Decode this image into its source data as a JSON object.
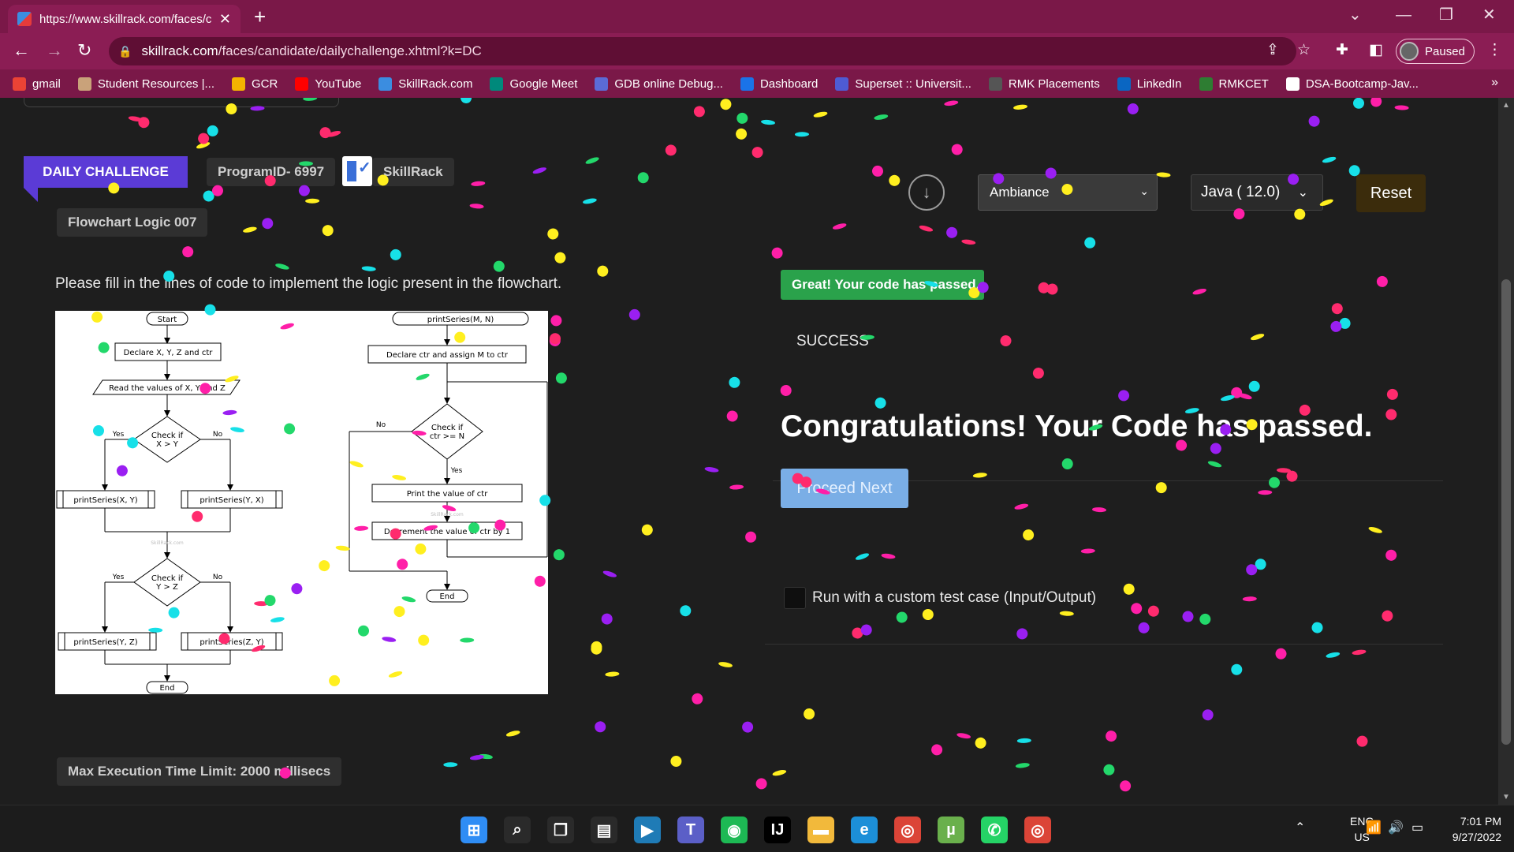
{
  "browser": {
    "tab_title": "https://www.skillrack.com/faces/c",
    "url_domain": "skillrack.com",
    "url_path": "/faces/candidate/dailychallenge.xhtml?k=DC",
    "profile_status": "Paused",
    "bookmarks": [
      {
        "label": "gmail",
        "color": "#ea4335"
      },
      {
        "label": "Student Resources |...",
        "color": "#c9a27a"
      },
      {
        "label": "GCR",
        "color": "#f4b400"
      },
      {
        "label": "YouTube",
        "color": "#ff0000"
      },
      {
        "label": "SkillRack.com",
        "color": "#3b8de0"
      },
      {
        "label": "Google Meet",
        "color": "#00897b"
      },
      {
        "label": "GDB online Debug...",
        "color": "#5b6bd6"
      },
      {
        "label": "Dashboard",
        "color": "#1a73e8"
      },
      {
        "label": "Superset :: Universit...",
        "color": "#4e5bd4"
      },
      {
        "label": "RMK Placements",
        "color": "#555555"
      },
      {
        "label": "LinkedIn",
        "color": "#0a66c2"
      },
      {
        "label": "RMKCET",
        "color": "#2e7d32"
      },
      {
        "label": "DSA-Bootcamp-Jav...",
        "color": "#ffffff"
      }
    ]
  },
  "challenge": {
    "badge": "DAILY CHALLENGE",
    "program_id": "ProgramID- 6997",
    "brand": "SkillRack",
    "title": "Flowchart Logic 007",
    "problem_text": "Please fill in the lines of code to implement the logic present in the flowchart.",
    "max_exec": "Max Execution Time Limit: 2000 millisecs"
  },
  "flowchart": {
    "left": {
      "start": "Start",
      "declare": "Declare X, Y, Z and ctr",
      "read": "Read the values of X, Y and Z",
      "cond1": [
        "Check if",
        "X > Y"
      ],
      "yes": "Yes",
      "no": "No",
      "p1": "printSeries(X, Y)",
      "p2": "printSeries(Y, X)",
      "cond2": [
        "Check if",
        "Y > Z"
      ],
      "p3": "printSeries(Y, Z)",
      "p4": "printSeries(Z, Y)",
      "end": "End",
      "watermark": "SkillRack.com"
    },
    "right": {
      "start": "printSeries(M, N)",
      "declare": "Declare ctr and assign M to ctr",
      "cond": [
        "Check if",
        "ctr >= N"
      ],
      "no": "No",
      "yes": "Yes",
      "print": "Print the value of ctr",
      "dec": "Decrement the value of ctr by 1",
      "end": "End",
      "watermark": "SkillRack.com"
    }
  },
  "editor": {
    "theme": "Ambiance",
    "language": "Java ( 12.0)",
    "reset": "Reset",
    "pass_badge": "Great! Your code has passed.",
    "status": "SUCCESS",
    "congrats": "Congratulations! Your Code has passed.",
    "proceed": "Proceed Next",
    "custom_run": "Run with a custom test case (Input/Output)"
  },
  "taskbar": {
    "language": [
      "ENG",
      "US"
    ],
    "time": "7:01 PM",
    "date": "9/27/2022",
    "apps": [
      {
        "name": "windows-start",
        "color": "#2f8df5"
      },
      {
        "name": "search",
        "color": "#2a2a2a"
      },
      {
        "name": "task-view",
        "color": "#2a2a2a"
      },
      {
        "name": "microsoft-store",
        "color": "#2a2a2a"
      },
      {
        "name": "prime-video",
        "color": "#1f7bb6"
      },
      {
        "name": "teams",
        "color": "#5b5fc7"
      },
      {
        "name": "spotify",
        "color": "#1db954"
      },
      {
        "name": "intellij",
        "color": "#000000"
      },
      {
        "name": "file-explorer",
        "color": "#f2b93b"
      },
      {
        "name": "edge",
        "color": "#1c8fd8"
      },
      {
        "name": "chrome",
        "color": "#db4437"
      },
      {
        "name": "utorrent",
        "color": "#6ab04c"
      },
      {
        "name": "whatsapp",
        "color": "#25d366"
      },
      {
        "name": "chrome-profile",
        "color": "#db4437"
      }
    ]
  }
}
